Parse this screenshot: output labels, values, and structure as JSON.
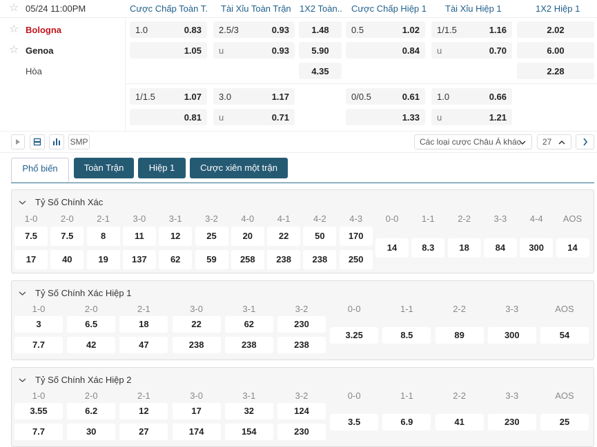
{
  "header": {
    "date": "05/24 11:00PM",
    "cols": [
      "Cược Chấp Toàn T...",
      "Tài Xỉu Toàn Trận",
      "1X2 Toàn...",
      "Cược Chấp Hiệp 1",
      "Tài Xỉu Hiệp 1",
      "1X2 Hiệp 1"
    ]
  },
  "teams": {
    "home": "Bologna",
    "away": "Genoa",
    "draw": "Hòa"
  },
  "odds": {
    "r1": {
      "hcp": "1.0",
      "hcp_home": "0.83",
      "ou": "2.5/3",
      "ou_over": "0.93",
      "x12_home": "1.48",
      "h1_hcp": "0.5",
      "h1_hcp_home": "1.02",
      "h1_ou": "1/1.5",
      "h1_ou_over": "1.16",
      "h1_x12_home": "2.02"
    },
    "r2": {
      "hcp_away": "1.05",
      "ou_u": "u",
      "ou_under": "0.93",
      "x12_away": "5.90",
      "h1_hcp_away": "0.84",
      "h1_ou_u": "u",
      "h1_ou_under": "0.70",
      "h1_x12_away": "6.00"
    },
    "r3": {
      "x12_draw": "4.35",
      "h1_x12_draw": "2.28"
    },
    "r4": {
      "hcp": "1/1.5",
      "hcp_home": "1.07",
      "ou": "3.0",
      "ou_over": "1.17",
      "h1_hcp": "0/0.5",
      "h1_hcp_home": "0.61",
      "h1_ou": "1.0",
      "h1_ou_over": "0.66"
    },
    "r5": {
      "hcp_away": "0.81",
      "ou_u": "u",
      "ou_under": "0.71",
      "h1_hcp_away": "1.33",
      "h1_ou_u": "u",
      "h1_ou_under": "1.21"
    }
  },
  "toolbar": {
    "smp": "SMP",
    "market": "Các loại cược Châu Á khác",
    "count": "27"
  },
  "tabs": [
    "Phổ biến",
    "Toàn Trận",
    "Hiệp 1",
    "Cược xiên một trận"
  ],
  "sections": [
    {
      "title": "Tỷ Số Chính Xác",
      "home_labels": [
        "1-0",
        "2-0",
        "2-1",
        "3-0",
        "3-1",
        "3-2",
        "4-0",
        "4-1",
        "4-2",
        "4-3"
      ],
      "home_top": [
        "7.5",
        "7.5",
        "8",
        "11",
        "12",
        "25",
        "20",
        "22",
        "50",
        "170"
      ],
      "home_bot": [
        "17",
        "40",
        "19",
        "137",
        "62",
        "59",
        "258",
        "238",
        "238",
        "250"
      ],
      "draw_labels": [
        "0-0",
        "1-1",
        "2-2",
        "3-3",
        "4-4",
        "AOS"
      ],
      "draw_vals": [
        "14",
        "8.3",
        "18",
        "84",
        "300",
        "14"
      ]
    },
    {
      "title": "Tỷ Số Chính Xác Hiệp 1",
      "home_labels": [
        "1-0",
        "2-0",
        "2-1",
        "3-0",
        "3-1",
        "3-2"
      ],
      "home_top": [
        "3",
        "6.5",
        "18",
        "22",
        "62",
        "230"
      ],
      "home_bot": [
        "7.7",
        "42",
        "47",
        "238",
        "238",
        "238"
      ],
      "draw_labels": [
        "0-0",
        "1-1",
        "2-2",
        "3-3",
        "AOS"
      ],
      "draw_vals": [
        "3.25",
        "8.5",
        "89",
        "300",
        "54"
      ]
    },
    {
      "title": "Tỷ Số Chính Xác Hiệp 2",
      "home_labels": [
        "1-0",
        "2-0",
        "2-1",
        "3-0",
        "3-1",
        "3-2"
      ],
      "home_top": [
        "3.55",
        "6.2",
        "12",
        "17",
        "32",
        "124"
      ],
      "home_bot": [
        "7.7",
        "30",
        "27",
        "174",
        "154",
        "230"
      ],
      "draw_labels": [
        "0-0",
        "1-1",
        "2-2",
        "3-3",
        "AOS"
      ],
      "draw_vals": [
        "3.5",
        "6.9",
        "41",
        "230",
        "25"
      ]
    }
  ],
  "colors": {
    "accent": "#1f5f8b",
    "tab_dark": "#255a73",
    "home_team": "#c0141c"
  }
}
